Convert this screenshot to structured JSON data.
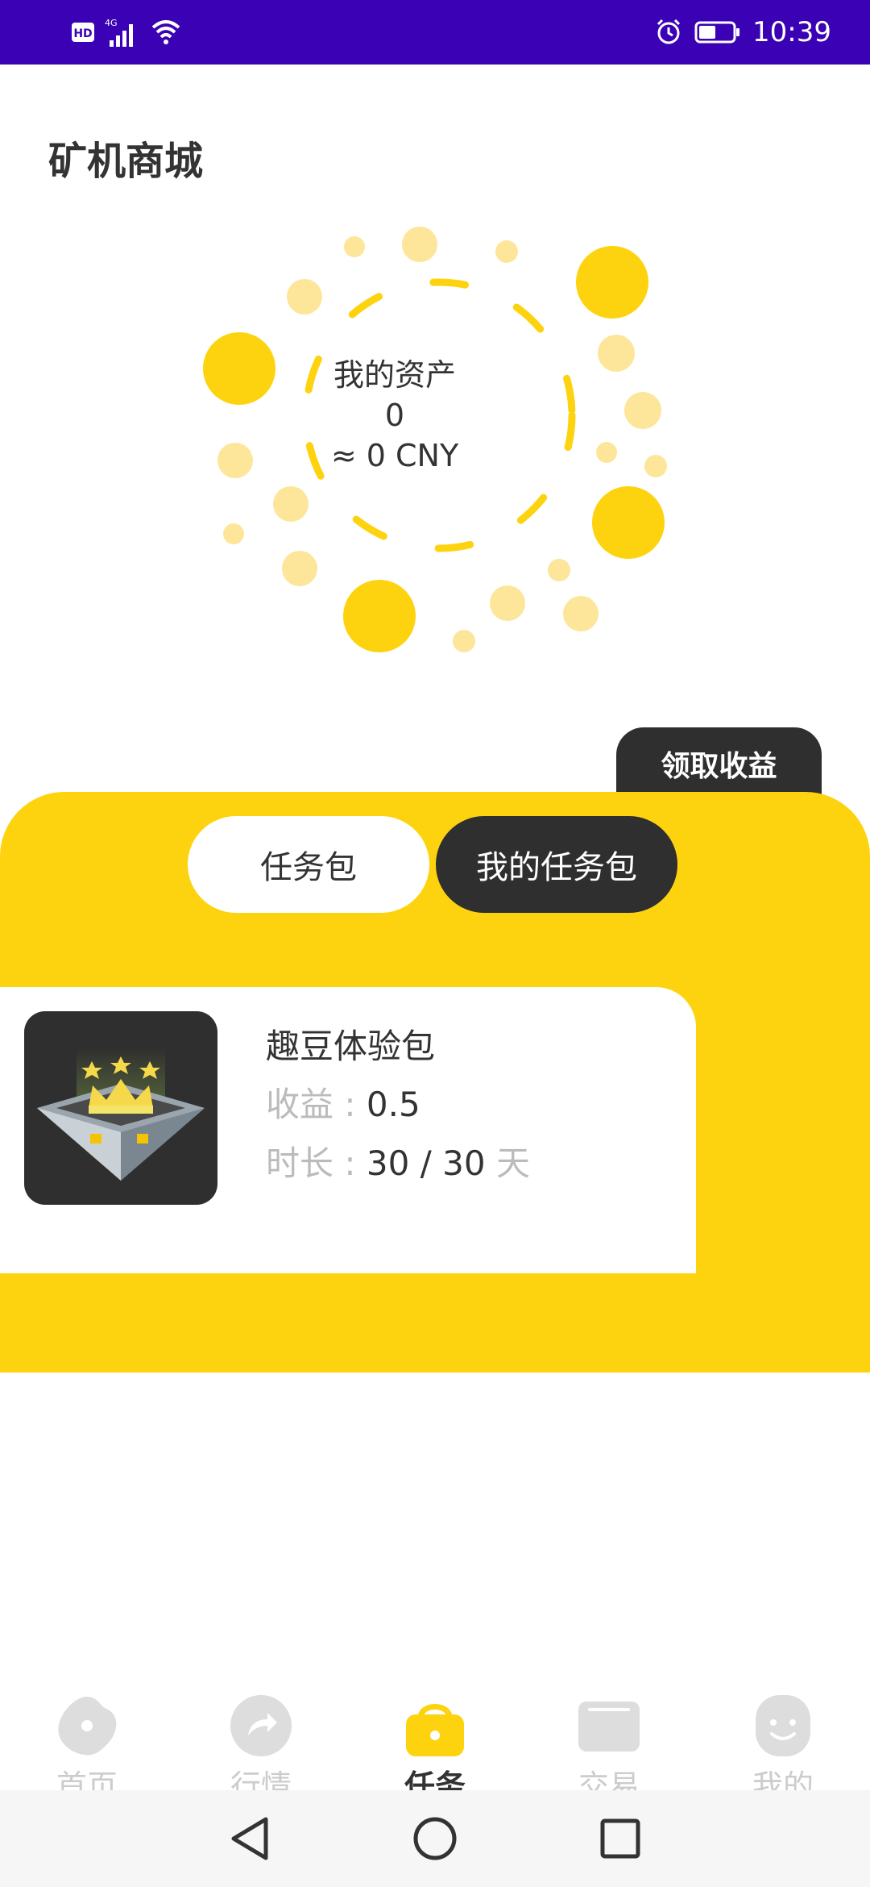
{
  "status_bar": {
    "time": "10:39",
    "left_icons": [
      "hd-icon",
      "4g-signal-icon",
      "wifi-icon"
    ],
    "right_icons": [
      "alarm-icon",
      "battery-icon"
    ]
  },
  "page": {
    "title": "矿机商城"
  },
  "assets": {
    "label": "我的资产",
    "amount": "0",
    "cny": "≈ 0 CNY"
  },
  "claim_button": {
    "label": "领取收益"
  },
  "tabs": [
    {
      "label": "任务包",
      "active": false
    },
    {
      "label": "我的任务包",
      "active": true
    }
  ],
  "task": {
    "name": "趣豆体验包",
    "earnings_label": "收益 :",
    "earnings_value": "0.5",
    "duration_label": "时长 :",
    "duration_value": "30 / 30",
    "duration_unit": "天",
    "image_icon": "crown-box-icon"
  },
  "bottom_nav": [
    {
      "label": "首页",
      "icon": "flower-home-icon",
      "active": false
    },
    {
      "label": "行情",
      "icon": "share-arrow-icon",
      "active": false
    },
    {
      "label": "任务",
      "icon": "bag-icon",
      "active": true
    },
    {
      "label": "交易",
      "icon": "wallet-icon",
      "active": false
    },
    {
      "label": "我的",
      "icon": "smile-face-icon",
      "active": false
    }
  ],
  "colors": {
    "status_bar": "#3a02b4",
    "accent_yellow": "#fdd30f",
    "dark": "#2f2f2f",
    "muted_text": "#bbbbbb"
  },
  "system_nav": [
    "back-icon",
    "home-icon",
    "recents-icon"
  ]
}
